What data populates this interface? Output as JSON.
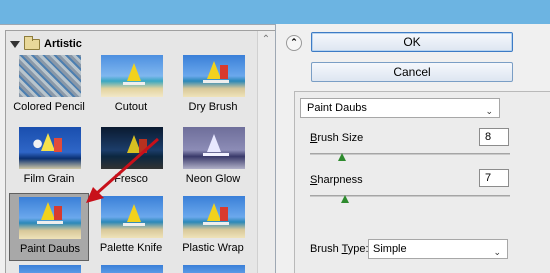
{
  "gallery": {
    "category": "Artistic",
    "filters": [
      {
        "label": "Colored Pencil"
      },
      {
        "label": "Cutout"
      },
      {
        "label": "Dry Brush"
      },
      {
        "label": "Film Grain"
      },
      {
        "label": "Fresco"
      },
      {
        "label": "Neon Glow"
      },
      {
        "label": "Paint Daubs"
      },
      {
        "label": "Palette Knife"
      },
      {
        "label": "Plastic Wrap"
      }
    ],
    "selected": "Paint Daubs"
  },
  "actions": {
    "ok_label": "OK",
    "cancel_label": "Cancel"
  },
  "settings": {
    "filter_selected": "Paint Daubs",
    "brush_size": {
      "label_underlined": "B",
      "label_rest": "rush Size",
      "value": "8",
      "level": 0.16
    },
    "sharpness": {
      "label_underlined": "S",
      "label_rest": "harpness",
      "value": "7",
      "level": 0.175
    },
    "brush_type": {
      "label_pre": "Brush ",
      "label_underlined": "T",
      "label_post": "ype:",
      "value": "Simple"
    }
  },
  "colors": {
    "background": "#6cb4e2",
    "panel": "#f0f0f0",
    "annotation_arrow": "#c8101a",
    "slider_thumb": "#2e8b2e"
  }
}
